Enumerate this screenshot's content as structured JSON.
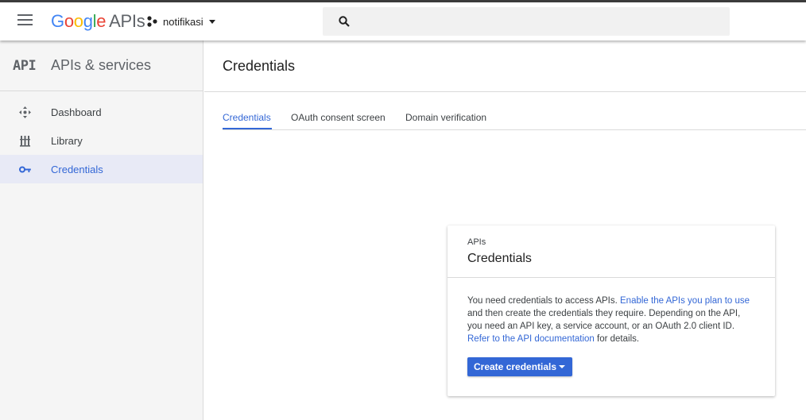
{
  "topbar": {
    "logo": {
      "g1": "G",
      "o1": "o",
      "o2": "o",
      "g2": "g",
      "l": "l",
      "e": "e",
      "apis": "APIs"
    },
    "project_name": "notifikasi",
    "search_placeholder": "",
    "icons": {
      "menu": "hamburger-menu-icon",
      "project": "project-dots-icon",
      "search": "search-icon"
    }
  },
  "sidebar": {
    "badge": "API",
    "title": "APIs & services",
    "items": [
      {
        "label": "Dashboard",
        "icon": "dashboard-icon",
        "active": false
      },
      {
        "label": "Library",
        "icon": "library-icon",
        "active": false
      },
      {
        "label": "Credentials",
        "icon": "key-icon",
        "active": true
      }
    ]
  },
  "main": {
    "title": "Credentials",
    "tabs": [
      {
        "label": "Credentials",
        "active": true
      },
      {
        "label": "OAuth consent screen",
        "active": false
      },
      {
        "label": "Domain verification",
        "active": false
      }
    ]
  },
  "card": {
    "eyebrow": "APIs",
    "title": "Credentials",
    "text1": "You need credentials to access APIs. ",
    "link1": "Enable the APIs you plan to use",
    "text2": " and then create the credentials they require. Depending on the API, you need an API key, a service account, or an OAuth 2.0 client ID. ",
    "link2": "Refer to the API documentation",
    "text3": " for details.",
    "button_label": "Create credentials"
  },
  "colors": {
    "accent": "#3367d6",
    "active_nav_bg": "#e8eaf6",
    "sidebar_bg": "#f5f5f5"
  }
}
